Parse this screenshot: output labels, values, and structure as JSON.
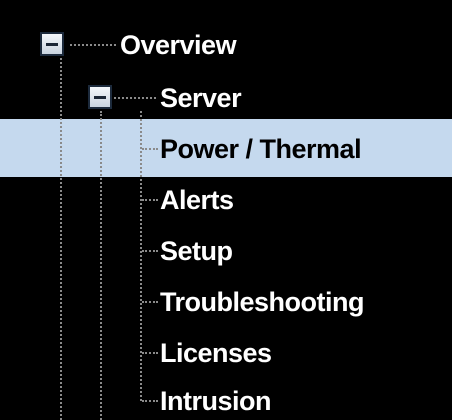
{
  "tree": {
    "root": {
      "label": "Overview",
      "expanded": true
    },
    "server": {
      "label": "Server",
      "expanded": true
    },
    "children": [
      {
        "label": "Power / Thermal",
        "selected": true
      },
      {
        "label": "Alerts",
        "selected": false
      },
      {
        "label": "Setup",
        "selected": false
      },
      {
        "label": "Troubleshooting",
        "selected": false
      },
      {
        "label": "Licenses",
        "selected": false
      },
      {
        "label": "Intrusion",
        "selected": false
      }
    ]
  },
  "colors": {
    "background": "#000000",
    "selected_row": "#c5d9ee",
    "text": "#ffffff",
    "selected_text": "#000000",
    "guide_lines": "#8a8a8a"
  }
}
